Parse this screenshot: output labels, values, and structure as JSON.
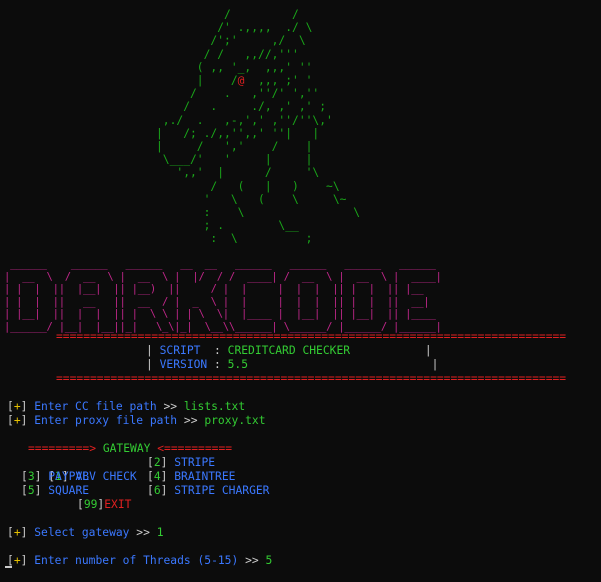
{
  "ascii_art": {
    "lines": [
      "          /         /",
      "         /' .,,,,  ./ \\",
      "        /';'     ,/  \\",
      "       / /   ,,//,'''",
      "      ( ,, '_,  ,,,' ''",
      "      |    /@  ,,, ;' '",
      "     /    .   ,''/' ',''",
      "    /   .     ./, ,' ,' ;",
      " ,./  .   ,-,',' ,''/''\\,'",
      "|   /; ./,,'',,' ''|   |",
      "|     /   ','    /    |",
      " \\___/'   '     |     |",
      "   ',,'  |      /     '\\",
      "        /   (   |   )    ~\\",
      "       '   \\   (    \\     \\~",
      "       :    \\                \\",
      "       ; .        \\__",
      "        :  \\          ;"
    ],
    "eye_char": "@"
  },
  "logo": {
    "text": "DARKCODE",
    "lines": [
      " ______    ______   ______   __  __   ______   ______   ______   ______ ",
      "|  __  \\  /  __  \\ |  __  \\ |  |/  / /  ____| /  __  \\ |  __  \\ |  ____|",
      "| |  |  ||  |__|  || |__)  ||     / |  |     |  |  |  || |  |  || |__   ",
      "| |  |  ||   __   ||  __  / |  _  \\ |  |     |  |  |  || |  |  ||  __|  ",
      "| |__|  ||  |  |  || |  \\ \\ | | \\  \\|  |____ |  |__|  || |__|  || |____ ",
      "|______/ |__|  |__||_|   \\_\\|_|  \\__\\\\______| \\______/ |______/ |______|"
    ]
  },
  "separator": "===========================================================================",
  "info": {
    "script_label": "SCRIPT",
    "script_value": "CREDITCARD CHECKER",
    "version_label": "VERSION",
    "version_value": "5.5"
  },
  "prompts": {
    "plus": "+",
    "cc_label": "Enter CC file path",
    "cc_value": "lists.txt",
    "proxy_label": "Enter proxy file path",
    "proxy_value": "proxy.txt",
    "arrow": ">>"
  },
  "gateway": {
    "left_arrow": "=========>",
    "title": "GATEWAY",
    "right_arrow": "<==========",
    "options": [
      {
        "num": "1",
        "label": "VBV CHECK"
      },
      {
        "num": "2",
        "label": "STRIPE"
      },
      {
        "num": "3",
        "label": "PAYPAL"
      },
      {
        "num": "4",
        "label": "BRAINTREE"
      },
      {
        "num": "5",
        "label": "SQUARE"
      },
      {
        "num": "6",
        "label": "STRIPE CHARGER"
      }
    ],
    "exit_num": "99",
    "exit_label": "EXIT"
  },
  "select": {
    "label": "Select gateway",
    "value": "1"
  },
  "threads": {
    "label": "Enter number of Threads (5-15)",
    "value": "5"
  },
  "colors": {
    "background": "#0c0c0c",
    "green": "#33cc33",
    "blue": "#3b78ff",
    "red": "#e02020",
    "magenta": "#c0278a",
    "yellow": "#e5c000"
  }
}
